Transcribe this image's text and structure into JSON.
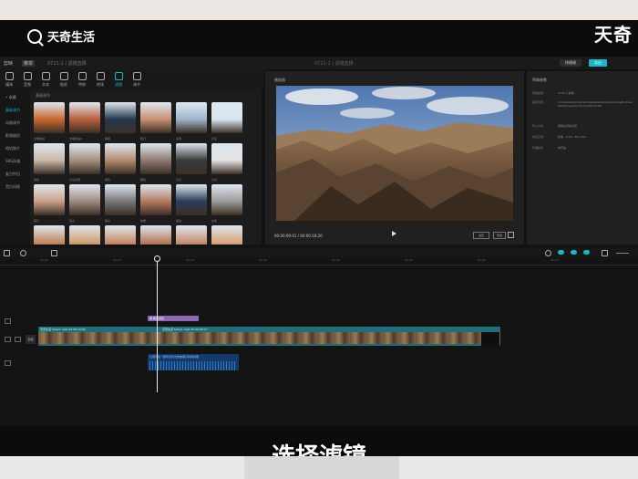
{
  "watermark": {
    "text": "天奇生活",
    "corner_logo": "天奇"
  },
  "subtitle": "选择滤镜",
  "app": {
    "title": "剪映",
    "tab": "菜单",
    "draft_name": "0721-1 | 滤镜选择",
    "shortcut_btn": "快捷键",
    "export_btn": "导出"
  },
  "toolbar": {
    "items": [
      {
        "label": "媒体",
        "icon": "media-icon"
      },
      {
        "label": "音频",
        "icon": "audio-icon"
      },
      {
        "label": "文本",
        "icon": "text-icon"
      },
      {
        "label": "贴纸",
        "icon": "sticker-icon"
      },
      {
        "label": "特效",
        "icon": "effects-icon"
      },
      {
        "label": "转场",
        "icon": "transition-icon"
      },
      {
        "label": "滤镜",
        "icon": "filter-icon",
        "active": true
      },
      {
        "label": "调节",
        "icon": "adjust-icon"
      }
    ]
  },
  "filter_sidebar": {
    "items": [
      {
        "label": "• 收藏",
        "active": false
      },
      {
        "label": "基础调节",
        "active": true
      },
      {
        "label": "风格调节",
        "active": false
      },
      {
        "label": "影视级别",
        "active": false
      },
      {
        "label": "相机胶片",
        "active": false
      },
      {
        "label": "SKG风格",
        "active": false
      },
      {
        "label": "复古怀旧",
        "active": false
      },
      {
        "label": "黑白风格",
        "active": false
      }
    ]
  },
  "filter_panel": {
    "header": "基础调节",
    "thumbs": [
      {
        "label": "文理性感",
        "color": "#c9672c"
      },
      {
        "label": "文理性感II",
        "color": "#b9603a"
      },
      {
        "label": "暗调",
        "color": "#26384f"
      },
      {
        "label": "暖日",
        "color": "#c99070"
      },
      {
        "label": "蓝调",
        "color": "#9fb6cf"
      },
      {
        "label": "天空",
        "color": "#d8e6f0"
      },
      {
        "label": "海边",
        "color": "#c9b8a8"
      },
      {
        "label": "午后淡阳",
        "color": "#a59080"
      },
      {
        "label": "黄昏",
        "color": "#b58a70"
      },
      {
        "label": "暮色",
        "color": "#8e7a72"
      },
      {
        "label": "日光",
        "color": "#3a3a3a"
      },
      {
        "label": "冷白",
        "color": "#e2e2e2"
      },
      {
        "label": "夏日",
        "color": "#caa189"
      },
      {
        "label": "复古",
        "color": "#9f8b7e"
      },
      {
        "label": "黑白",
        "color": "#777777"
      },
      {
        "label": "晚霞",
        "color": "#b57a60"
      },
      {
        "label": "湖泊",
        "color": "#2a3c58"
      },
      {
        "label": "白色",
        "color": "#9a9a9a"
      },
      {
        "label": "",
        "color": "#c28860"
      },
      {
        "label": "",
        "color": "#d2a072"
      },
      {
        "label": "",
        "color": "#c98d6a"
      },
      {
        "label": "",
        "color": "#b77b5d"
      },
      {
        "label": "",
        "color": "#c59270"
      },
      {
        "label": "",
        "color": "#d7a57f"
      }
    ]
  },
  "player": {
    "title": "播放器",
    "timecode": "00:00:09:01 / 00:00:16:20",
    "ratio_btn": "适应",
    "orig_btn": "原始"
  },
  "draft_panel": {
    "title": "草稿参数",
    "rows": [
      {
        "k": "草稿名称:",
        "v": "0721-1 剪映"
      },
      {
        "k": "保存位置:",
        "v": "C:/Users/Administrator/AppData/Local/JianyingPro/User Data/Projects/com.lveditor.draft"
      },
      {
        "k": "导入方式:",
        "v": "保留在原始位置"
      },
      {
        "k": "色彩空间:",
        "v": "标准 · 8-bit · Rec.709"
      },
      {
        "k": "代理模式:",
        "v": "未开启"
      }
    ]
  },
  "timeline": {
    "ticks": [
      "00:00",
      "00:10",
      "00:20",
      "00:30",
      "00:40",
      "00:50",
      "01:00",
      "01:10"
    ],
    "filter_clip": "黑 暖日滤镜",
    "cover_btn": "封面",
    "clip_label_1": "天奇生活 fuzzy1.mp4  00:00:10:03",
    "clip_label_2": "天奇生活 fuzzy1.mp4  00:00:06:17",
    "audio_label": "让我们在一起听见时光的故事与时间的歌"
  }
}
